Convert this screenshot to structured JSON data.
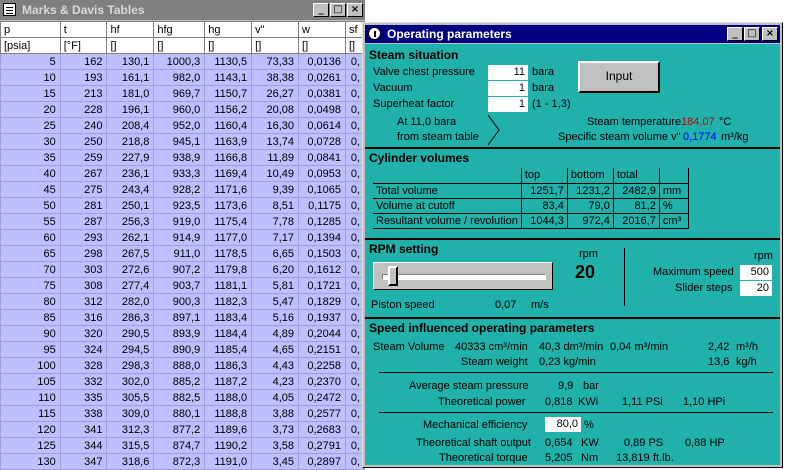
{
  "table_window": {
    "title": "Marks & Davis Tables",
    "headers": [
      "p",
      "t",
      "hf",
      "hfg",
      "hg",
      "v\"",
      "w",
      "sf"
    ],
    "units": [
      "[psia]",
      "[°F]",
      "[]",
      "[]",
      "[]",
      "[]",
      "[]",
      "[]"
    ],
    "rows": [
      [
        "5",
        "162",
        "130,1",
        "1000,3",
        "1130,5",
        "73,33",
        "0,0136",
        "0,"
      ],
      [
        "10",
        "193",
        "161,1",
        "982,0",
        "1143,1",
        "38,38",
        "0,0261",
        "0,"
      ],
      [
        "15",
        "213",
        "181,0",
        "969,7",
        "1150,7",
        "26,27",
        "0,0381",
        "0,"
      ],
      [
        "20",
        "228",
        "196,1",
        "960,0",
        "1156,2",
        "20,08",
        "0,0498",
        "0,"
      ],
      [
        "25",
        "240",
        "208,4",
        "952,0",
        "1160,4",
        "16,30",
        "0,0614",
        "0,"
      ],
      [
        "30",
        "250",
        "218,8",
        "945,1",
        "1163,9",
        "13,74",
        "0,0728",
        "0,"
      ],
      [
        "35",
        "259",
        "227,9",
        "938,9",
        "1166,8",
        "11,89",
        "0,0841",
        "0,"
      ],
      [
        "40",
        "267",
        "236,1",
        "933,3",
        "1169,4",
        "10,49",
        "0,0953",
        "0,"
      ],
      [
        "45",
        "275",
        "243,4",
        "928,2",
        "1171,6",
        "9,39",
        "0,1065",
        "0,"
      ],
      [
        "50",
        "281",
        "250,1",
        "923,5",
        "1173,6",
        "8,51",
        "0,1175",
        "0,"
      ],
      [
        "55",
        "287",
        "256,3",
        "919,0",
        "1175,4",
        "7,78",
        "0,1285",
        "0,"
      ],
      [
        "60",
        "293",
        "262,1",
        "914,9",
        "1177,0",
        "7,17",
        "0,1394",
        "0,"
      ],
      [
        "65",
        "298",
        "267,5",
        "911,0",
        "1178,5",
        "6,65",
        "0,1503",
        "0,"
      ],
      [
        "70",
        "303",
        "272,6",
        "907,2",
        "1179,8",
        "6,20",
        "0,1612",
        "0,"
      ],
      [
        "75",
        "308",
        "277,4",
        "903,7",
        "1181,1",
        "5,81",
        "0,1721",
        "0,"
      ],
      [
        "80",
        "312",
        "282,0",
        "900,3",
        "1182,3",
        "5,47",
        "0,1829",
        "0,"
      ],
      [
        "85",
        "316",
        "286,3",
        "897,1",
        "1183,4",
        "5,16",
        "0,1937",
        "0,"
      ],
      [
        "90",
        "320",
        "290,5",
        "893,9",
        "1184,4",
        "4,89",
        "0,2044",
        "0,"
      ],
      [
        "95",
        "324",
        "294,5",
        "890,9",
        "1185,4",
        "4,65",
        "0,2151",
        "0,"
      ],
      [
        "100",
        "328",
        "298,3",
        "888,0",
        "1186,3",
        "4,43",
        "0,2258",
        "0,"
      ],
      [
        "105",
        "332",
        "302,0",
        "885,2",
        "1187,2",
        "4,23",
        "0,2370",
        "0,"
      ],
      [
        "110",
        "335",
        "305,5",
        "882,5",
        "1188,0",
        "4,05",
        "0,2472",
        "0,"
      ],
      [
        "115",
        "338",
        "309,0",
        "880,1",
        "1188,8",
        "3,88",
        "0,2577",
        "0,"
      ],
      [
        "120",
        "341",
        "312,3",
        "877,2",
        "1189,6",
        "3,73",
        "0,2683",
        "0,"
      ],
      [
        "125",
        "344",
        "315,5",
        "874,7",
        "1190,2",
        "3,58",
        "0,2791",
        "0,"
      ],
      [
        "130",
        "347",
        "318,6",
        "872,3",
        "1191,0",
        "3,45",
        "0,2897",
        "0,"
      ]
    ]
  },
  "op_window": {
    "title": "Operating parameters",
    "steam": {
      "heading": "Steam situation",
      "valve_label": "Valve chest pressure",
      "valve_value": "11",
      "valve_unit": "bara",
      "vacuum_label": "Vacuum",
      "vacuum_value": "1",
      "vacuum_unit": "bara",
      "superheat_label": "Superheat factor",
      "superheat_value": "1",
      "superheat_unit": "(1 - 1,3)",
      "input_button": "Input",
      "at_text": "At     11,0 bara",
      "from_text": "from steam table",
      "temp_label": "Steam temperature",
      "temp_value": "184,07",
      "temp_unit": "°C",
      "vol_label": "Specific steam volume v\"",
      "vol_value": "0,1774",
      "vol_unit": "m³/kg"
    },
    "cylinder": {
      "heading": "Cylinder volumes",
      "col_top": "top",
      "col_bottom": "bottom",
      "col_total": "total",
      "rows": [
        {
          "label": "Total volume",
          "top": "1251,7",
          "bottom": "1231,2",
          "total": "2482,9",
          "unit": "mm"
        },
        {
          "label": "Volume at cutoff",
          "top": "83,4",
          "bottom": "79,0",
          "total": "81,2",
          "unit": "%"
        },
        {
          "label": "Resultant volume / revolution",
          "top": "1044,3",
          "bottom": "972,4",
          "total": "2016,7",
          "unit": "cm³"
        }
      ]
    },
    "rpm": {
      "heading": "RPM setting",
      "rpm_unit": "rpm",
      "rpm_value": "20",
      "piston_label": "Piston speed",
      "piston_value": "0,07",
      "piston_unit": "m/s",
      "max_unit": "rpm",
      "max_label": "Maximum speed",
      "max_value": "500",
      "steps_label": "Slider steps",
      "steps_value": "20",
      "slider_level": 0.04
    },
    "speed": {
      "heading": "Speed influenced operating parameters",
      "steam_volume_label": "Steam Volume",
      "sv1": "40333 cm³/min",
      "sv2": "40,3 dm³/min",
      "sv3": "0,04 m³/min",
      "sv4": "2,42",
      "sv4_unit": "m³/h",
      "steam_weight_label": "Steam weight",
      "sw1": "0,23 kg/min",
      "sw2": "13,6",
      "sw2_unit": "kg/h",
      "avg_label": "Average steam pressure",
      "avg_value": "9,9",
      "avg_unit": "bar",
      "power_label": "Theoretical power",
      "power1": "0,818",
      "power1_unit": "KWi",
      "power2": "1,11 PSi",
      "power3": "1,10 HPi",
      "mech_label": "Mechanical efficiency",
      "mech_value": "80,0",
      "mech_unit": "%",
      "shaft_label": "Theoretical shaft output",
      "shaft1": "0,654",
      "shaft1_unit": "KW",
      "shaft2": "0,89 PS",
      "shaft3": "0,88 HP",
      "torque_label": "Theoretical torque",
      "torque1": "5,205",
      "torque1_unit": "Nm",
      "torque2": "13,819",
      "torque2_unit": "ft.lb."
    }
  },
  "window_buttons": {
    "minimize": "_",
    "maximize": "□",
    "close": "×"
  },
  "icons": {
    "table_window": "table-icon",
    "op_window": "bulb-icon"
  },
  "colors": {
    "client_bg": "#20b2aa",
    "table_rows": "#bfbfff",
    "title_active": "#000080",
    "title_inactive": "#808080"
  }
}
